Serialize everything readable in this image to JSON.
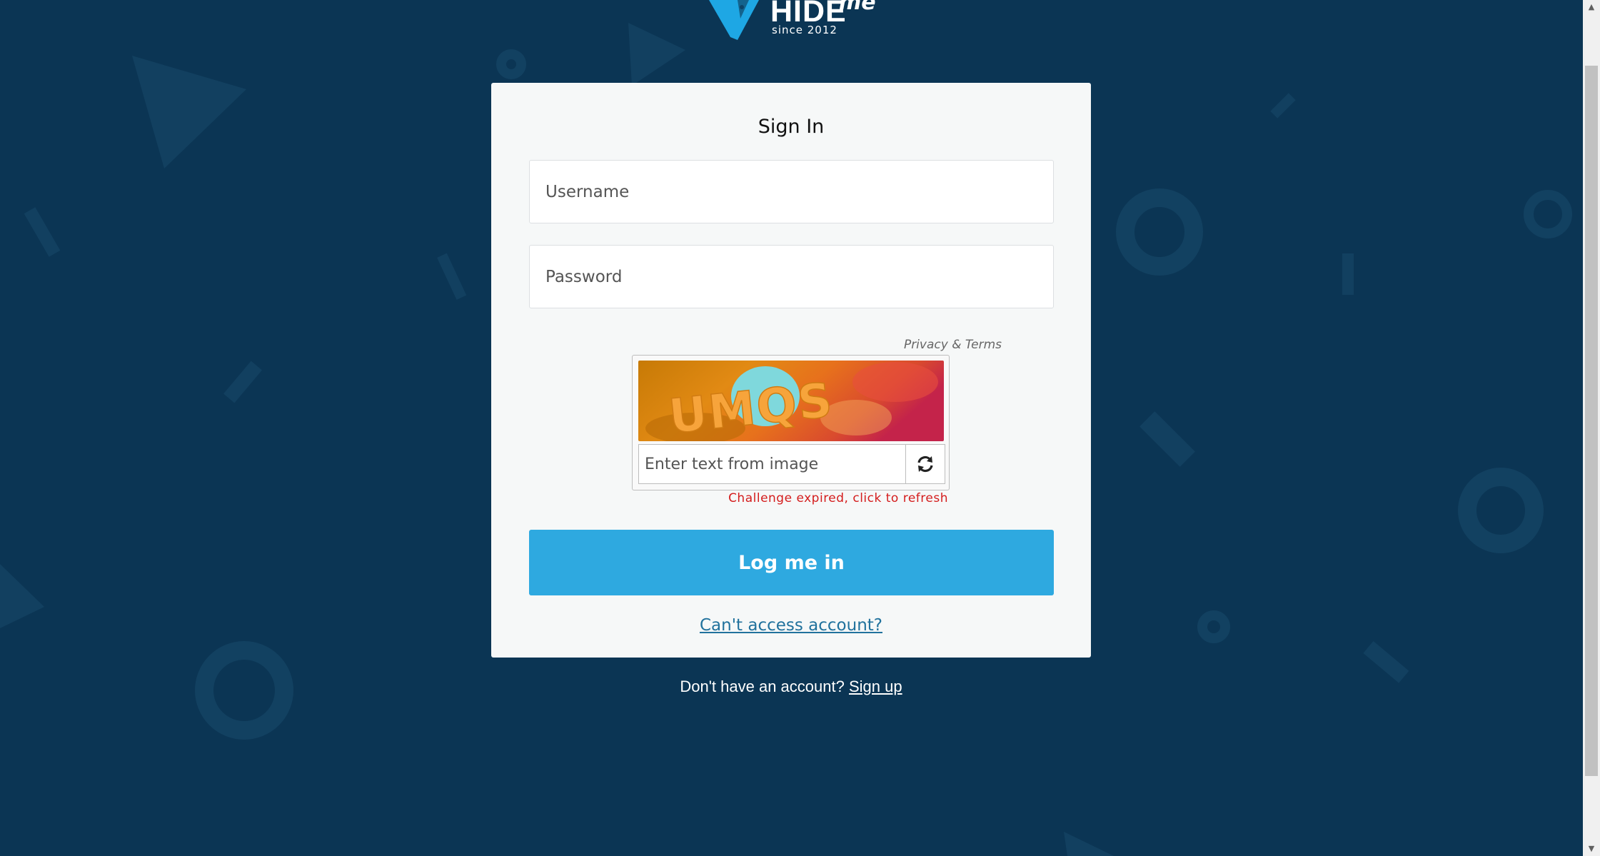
{
  "brand": {
    "name": "HIDE",
    "suffix": "me",
    "tagline": "since 2012",
    "colors": {
      "background": "#0b3554",
      "accent": "#2ea9e0",
      "logo_blue": "#1ea7e4"
    }
  },
  "signin": {
    "title": "Sign In",
    "username_placeholder": "Username",
    "password_placeholder": "Password",
    "captcha": {
      "privacy_label": "Privacy & Terms",
      "image_text": "UMQS",
      "input_placeholder": "Enter text from image",
      "refresh_icon": "refresh-icon",
      "error": "Challenge expired, click to refresh",
      "error_color": "#d41c1c"
    },
    "login_label": "Log me in",
    "cant_access_label": "Can't access account?"
  },
  "footer": {
    "prompt": "Don't have an account?",
    "signup_label": "Sign up"
  }
}
